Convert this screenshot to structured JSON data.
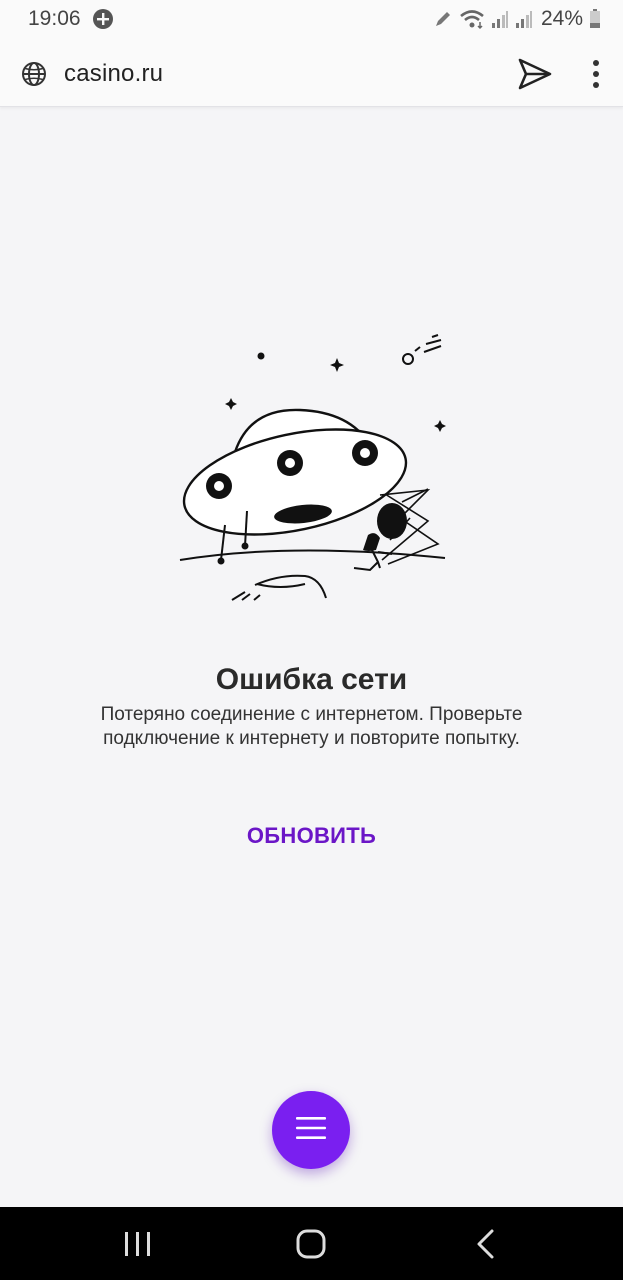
{
  "status_bar": {
    "time": "19:06",
    "battery": "24%",
    "icons": [
      "notification-plus-icon",
      "edit-icon",
      "wifi-icon",
      "signal-icon",
      "signal-icon",
      "battery-icon"
    ]
  },
  "browser": {
    "url": "casino.ru",
    "icons": [
      "globe-icon",
      "send-icon",
      "more-vert-icon"
    ]
  },
  "error": {
    "title": "Ошибка сети",
    "message": "Потеряно соединение с интернетом. Проверьте подключение к интернету и повторите попытку.",
    "refresh_label": "ОБНОВИТЬ"
  },
  "fab": {
    "icon": "hamburger-menu-icon",
    "color": "#7a1ff0"
  },
  "nav_bar": {
    "icons": [
      "recents-icon",
      "home-icon",
      "back-icon"
    ]
  },
  "colors": {
    "accent": "#6b16c7",
    "fab": "#7a1ff0",
    "background": "#f5f5f7"
  }
}
